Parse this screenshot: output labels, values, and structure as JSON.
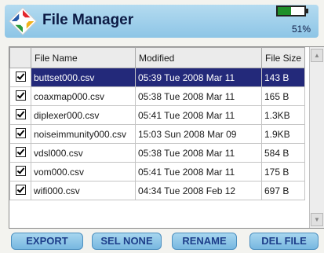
{
  "header": {
    "title": "File Manager",
    "battery_percent_label": "51%",
    "battery_level": 0.51
  },
  "table": {
    "columns": [
      "File Name",
      "Modified",
      "File Size"
    ],
    "rows": [
      {
        "name": "buttset000.csv",
        "modified": "05:39   Tue  2008 Mar 11",
        "size": "143 B",
        "checked": true,
        "selected": true
      },
      {
        "name": "coaxmap000.csv",
        "modified": "05:38   Tue  2008 Mar 11",
        "size": "165 B",
        "checked": true,
        "selected": false
      },
      {
        "name": "diplexer000.csv",
        "modified": "05:41   Tue  2008 Mar 11",
        "size": "1.3KB",
        "checked": true,
        "selected": false
      },
      {
        "name": "noiseimmunity000.csv",
        "modified": "15:03   Sun  2008 Mar 09",
        "size": "1.9KB",
        "checked": true,
        "selected": false
      },
      {
        "name": "vdsl000.csv",
        "modified": "05:38   Tue  2008 Mar 11",
        "size": "584 B",
        "checked": true,
        "selected": false
      },
      {
        "name": "vom000.csv",
        "modified": "05:41   Tue  2008 Mar 11",
        "size": "175 B",
        "checked": true,
        "selected": false
      },
      {
        "name": "wifi000.csv",
        "modified": "04:34   Tue  2008 Feb 12",
        "size": "697 B",
        "checked": true,
        "selected": false
      }
    ]
  },
  "buttons": {
    "export": "EXPORT",
    "sel_none": "SEL NONE",
    "rename": "RENAME",
    "del_file": "DEL FILE"
  },
  "colors": {
    "title_bar": "#9fd0ec",
    "selected_row": "#23297a",
    "button": "#8ec7e8",
    "button_text": "#1d3e8a",
    "battery_fill": "#1f8f2a"
  }
}
